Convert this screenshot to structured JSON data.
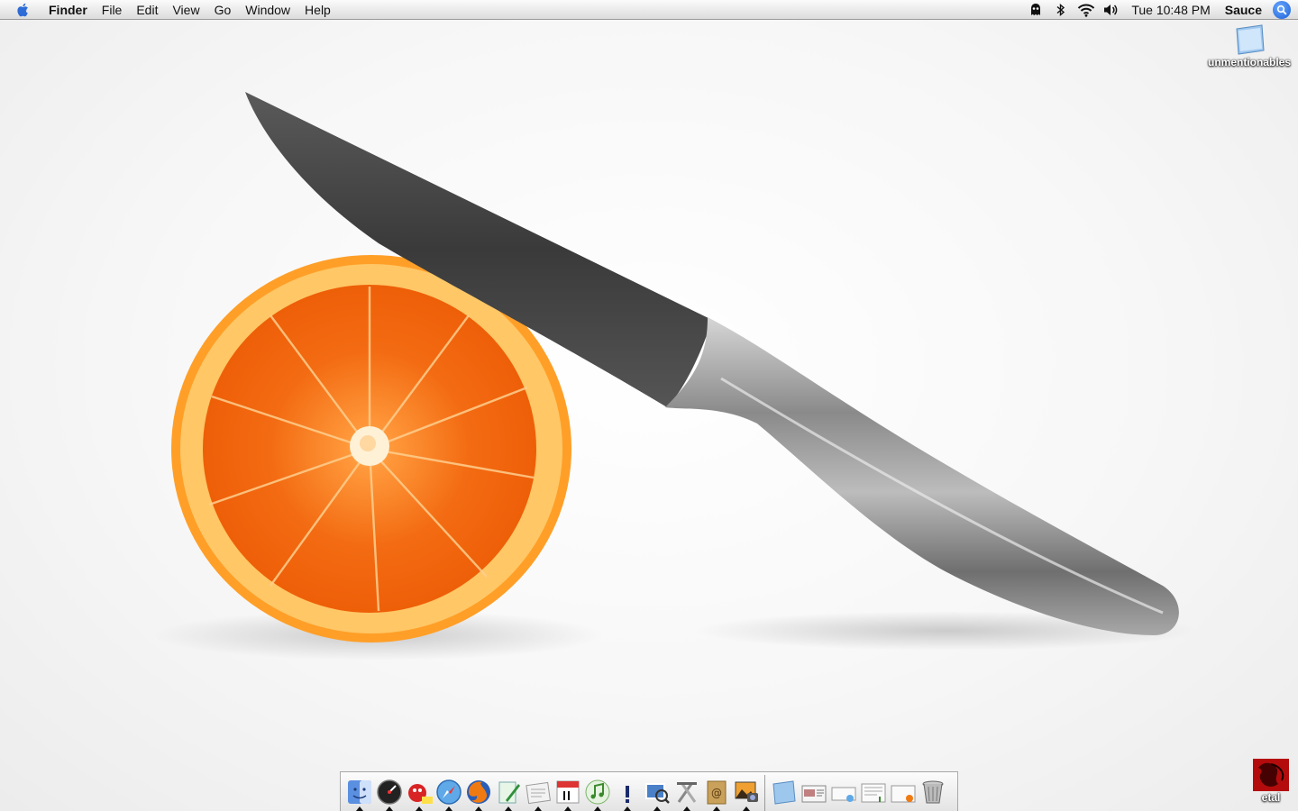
{
  "menubar": {
    "apple_icon": "apple-icon",
    "app_name": "Finder",
    "menus": [
      "File",
      "Edit",
      "View",
      "Go",
      "Window",
      "Help"
    ],
    "status_icons": [
      "ghost-icon",
      "bluetooth-icon",
      "wifi-icon",
      "volume-icon"
    ],
    "clock": "Tue 10:48 PM",
    "user": "Sauce",
    "spotlight_icon": "spotlight-icon"
  },
  "desktop": {
    "icons": [
      {
        "label": "unmentionables",
        "icon": "folder-icon"
      },
      {
        "label": "etal",
        "icon": "image-thumbnail-icon"
      }
    ]
  },
  "dock": {
    "apps": [
      {
        "icon": "finder-icon",
        "running": true
      },
      {
        "icon": "dashboard-icon",
        "running": true
      },
      {
        "icon": "adium-icon",
        "running": true
      },
      {
        "icon": "safari-icon",
        "running": true
      },
      {
        "icon": "firefox-icon",
        "running": true
      },
      {
        "icon": "textedit-icon",
        "running": true
      },
      {
        "icon": "stickies-icon",
        "running": true
      },
      {
        "icon": "ical-icon",
        "running": true
      },
      {
        "icon": "itunes-icon",
        "running": true
      },
      {
        "icon": "exclamation-icon",
        "running": true
      },
      {
        "icon": "preview-icon",
        "running": true
      },
      {
        "icon": "utilities-icon",
        "running": true
      },
      {
        "icon": "address-book-icon",
        "running": true
      },
      {
        "icon": "iphoto-icon",
        "running": true
      }
    ],
    "docs": [
      {
        "icon": "folder-icon"
      },
      {
        "icon": "minimized-window-icon"
      },
      {
        "icon": "minimized-window-icon"
      },
      {
        "icon": "minimized-window-icon"
      },
      {
        "icon": "minimized-window-icon"
      },
      {
        "icon": "trash-icon"
      }
    ]
  },
  "colors": {
    "orange": "#f36b12",
    "rind": "#ffb347",
    "blade": "#3f3f3f",
    "handle": "#9a9a9a"
  }
}
